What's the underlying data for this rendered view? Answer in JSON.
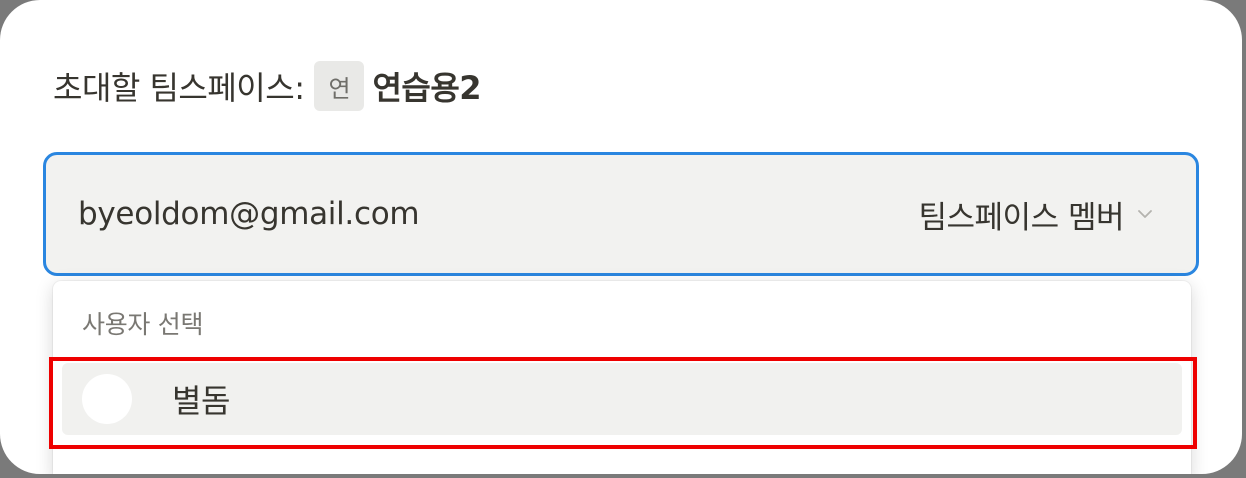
{
  "dialog": {
    "title_label": "초대할 팀스페이스:",
    "workspace_badge": "연",
    "workspace_name": "연습용2"
  },
  "invite": {
    "email_value": "byeoldom@gmail.com",
    "role_label": "팀스페이스 멤버",
    "role_icon": "chevron-down-icon"
  },
  "dropdown": {
    "heading": "사용자 선택",
    "options": [
      {
        "name": "별돔",
        "avatar": "avatar"
      }
    ]
  },
  "colors": {
    "focus_border": "#2a86e0",
    "highlight": "#ee0000"
  }
}
